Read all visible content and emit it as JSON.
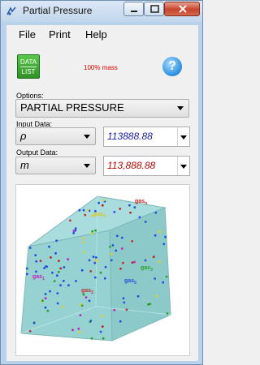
{
  "window": {
    "title": "Partial Pressure"
  },
  "menu": [
    "File",
    "Print",
    "Help"
  ],
  "toolbar": {
    "data_list_line1": "DATA",
    "data_list_line2": "LIST",
    "mass_note": "100% mass",
    "help_glyph": "?"
  },
  "options": {
    "label": "Options:",
    "selected": "PARTIAL PRESSURE"
  },
  "input": {
    "label": "Input Data:",
    "unit": "ρ",
    "value": "113888.88"
  },
  "output": {
    "label": "Output Data:",
    "unit": "m",
    "value": "113,888.88"
  },
  "diagram": {
    "labels": [
      {
        "text": "gas",
        "sub": "n",
        "color": "#c02020"
      },
      {
        "text": "gas",
        "sub": "4",
        "color": "#e0d020"
      },
      {
        "text": "gas",
        "sub": "3",
        "color": "#2aa02a"
      },
      {
        "text": "gas",
        "sub": "1",
        "color": "#c020c0"
      },
      {
        "text": "gas",
        "sub": "2",
        "color": "#c03030"
      },
      {
        "text": "gas",
        "sub": "5",
        "color": "#2050e0"
      }
    ]
  },
  "colors": {
    "input_value": "#1a1ab0",
    "output_value": "#c00000",
    "accent_green": "#3aa52f"
  }
}
